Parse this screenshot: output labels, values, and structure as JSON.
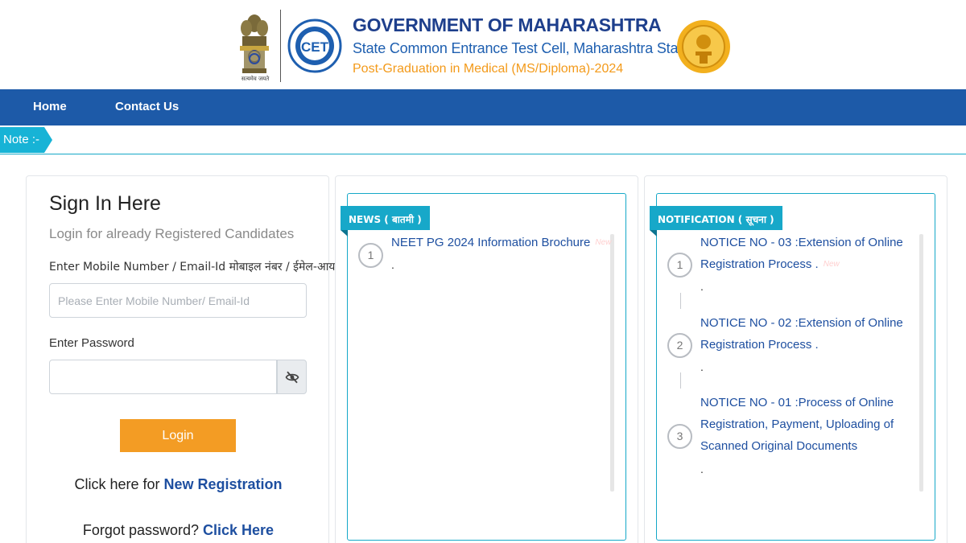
{
  "header": {
    "emblem_caption": "सत्यमेव जयते",
    "title_line1": "GOVERNMENT OF MAHARASHTRA",
    "title_line2": "State Common Entrance Test Cell, Maharashtra State",
    "title_line3": "Post-Graduation in Medical (MS/Diploma)-2024"
  },
  "nav": {
    "items": [
      {
        "label": "Home"
      },
      {
        "label": "Contact Us"
      }
    ]
  },
  "note": {
    "label": "Note :-"
  },
  "login": {
    "title": "Sign In Here",
    "subtitle": "Login for already Registered Candidates",
    "mobile_label": "Enter Mobile Number / Email-Id मोबाइल नंबर / ईमेल-आयडी",
    "mobile_placeholder": "Please Enter Mobile Number/ Email-Id",
    "password_label": "Enter Password",
    "login_button": "Login",
    "register_prefix": "Click here for ",
    "register_link": "New Registration",
    "forgot_prefix": "Forgot password? ",
    "forgot_link": "Click Here"
  },
  "news": {
    "tag": "NEWS ( बातमी )",
    "items": [
      {
        "num": "1",
        "title": "NEET PG 2024 Information Brochure",
        "badge": "New",
        "dot": "."
      }
    ]
  },
  "notifications": {
    "tag": "NOTIFICATION ( सूचना )",
    "items": [
      {
        "num": "1",
        "line1": "NOTICE NO - 03 :Extension of Online",
        "line2": "Registration Process .",
        "badge": "New",
        "dot": "."
      },
      {
        "num": "2",
        "line1": "NOTICE NO - 02 :Extension of Online",
        "line2": "Registration Process .",
        "dot": "."
      },
      {
        "num": "3",
        "line1": "NOTICE NO - 01 :Process of Online",
        "line2": "Registration, Payment, Uploading of",
        "line3": "Scanned Original Documents",
        "dot": "."
      }
    ]
  },
  "colors": {
    "nav_bg": "#1d5aa8",
    "accent_cyan": "#17a8c9",
    "login_button": "#f39c24",
    "link_blue": "#1e4fa0",
    "title_orange": "#f39a1a"
  }
}
